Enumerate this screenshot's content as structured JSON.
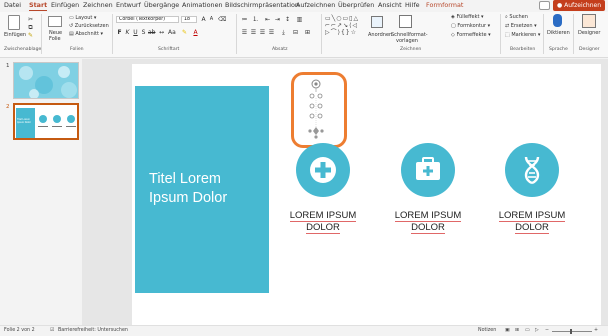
{
  "ribbon_tabs": {
    "file": "Datei",
    "start": "Start",
    "insert": "Einfügen",
    "draw": "Zeichnen",
    "design": "Entwurf",
    "transitions": "Übergänge",
    "animations": "Animationen",
    "slideshow": "Bildschirmpräsentation",
    "record": "Aufzeichnen",
    "review": "Überprüfen",
    "view": "Ansicht",
    "help": "Hilfe",
    "shape_format": "Formformat"
  },
  "share_button": "Aufzeichnen",
  "clipboard": {
    "paste": "Einfügen",
    "group": "Zwischenablage"
  },
  "slides_group": {
    "new_slide": "Neue",
    "new_slide_2": "Folie",
    "layout": "Layout",
    "reset": "Zurücksetzen",
    "section": "Abschnitt",
    "group": "Folien"
  },
  "font_group": {
    "font_name": "Corbel (Textkörper)",
    "font_size": "18",
    "group": "Schriftart"
  },
  "paragraph_group": {
    "group": "Absatz"
  },
  "drawing_group": {
    "arrange": "Anordnen",
    "quick_styles": "Schnellformat-",
    "quick_styles_2": "vorlagen",
    "fill": "Fülleffekt",
    "outline": "Formkontur",
    "effects": "Formeffekte",
    "group": "Zeichnen"
  },
  "editing_group": {
    "find": "Suchen",
    "replace": "Ersetzen",
    "select": "Markieren",
    "group": "Bearbeiten"
  },
  "voice_group": {
    "dictate": "Diktieren",
    "group": "Sprache"
  },
  "designer_group": {
    "designer": "Designer",
    "group": "Designer"
  },
  "thumbnails": {
    "slide1_number": "1",
    "slide2_number": "2",
    "slide2_title": "Titel Lorem Ipsum Dolor"
  },
  "slide": {
    "title_line1": "Titel Lorem",
    "title_line2": "Ipsum Dolor",
    "items": [
      {
        "line1": "LOREM IPSUM",
        "line2": "DOLOR",
        "icon": "medical-cross-icon"
      },
      {
        "line1": "LOREM IPSUM",
        "line2": "DOLOR",
        "icon": "first-aid-kit-icon"
      },
      {
        "line1": "LOREM IPSUM",
        "line2": "DOLOR",
        "icon": "dna-icon"
      }
    ]
  },
  "statusbar": {
    "slide_count": "Folie 2 von 2",
    "accessibility": "Barrierefreiheit: Untersuchen",
    "notes": "Notizen"
  },
  "colors": {
    "accent": "#47b9d1",
    "ribbon_accent": "#b7472a",
    "selection": "#ed7d31"
  }
}
